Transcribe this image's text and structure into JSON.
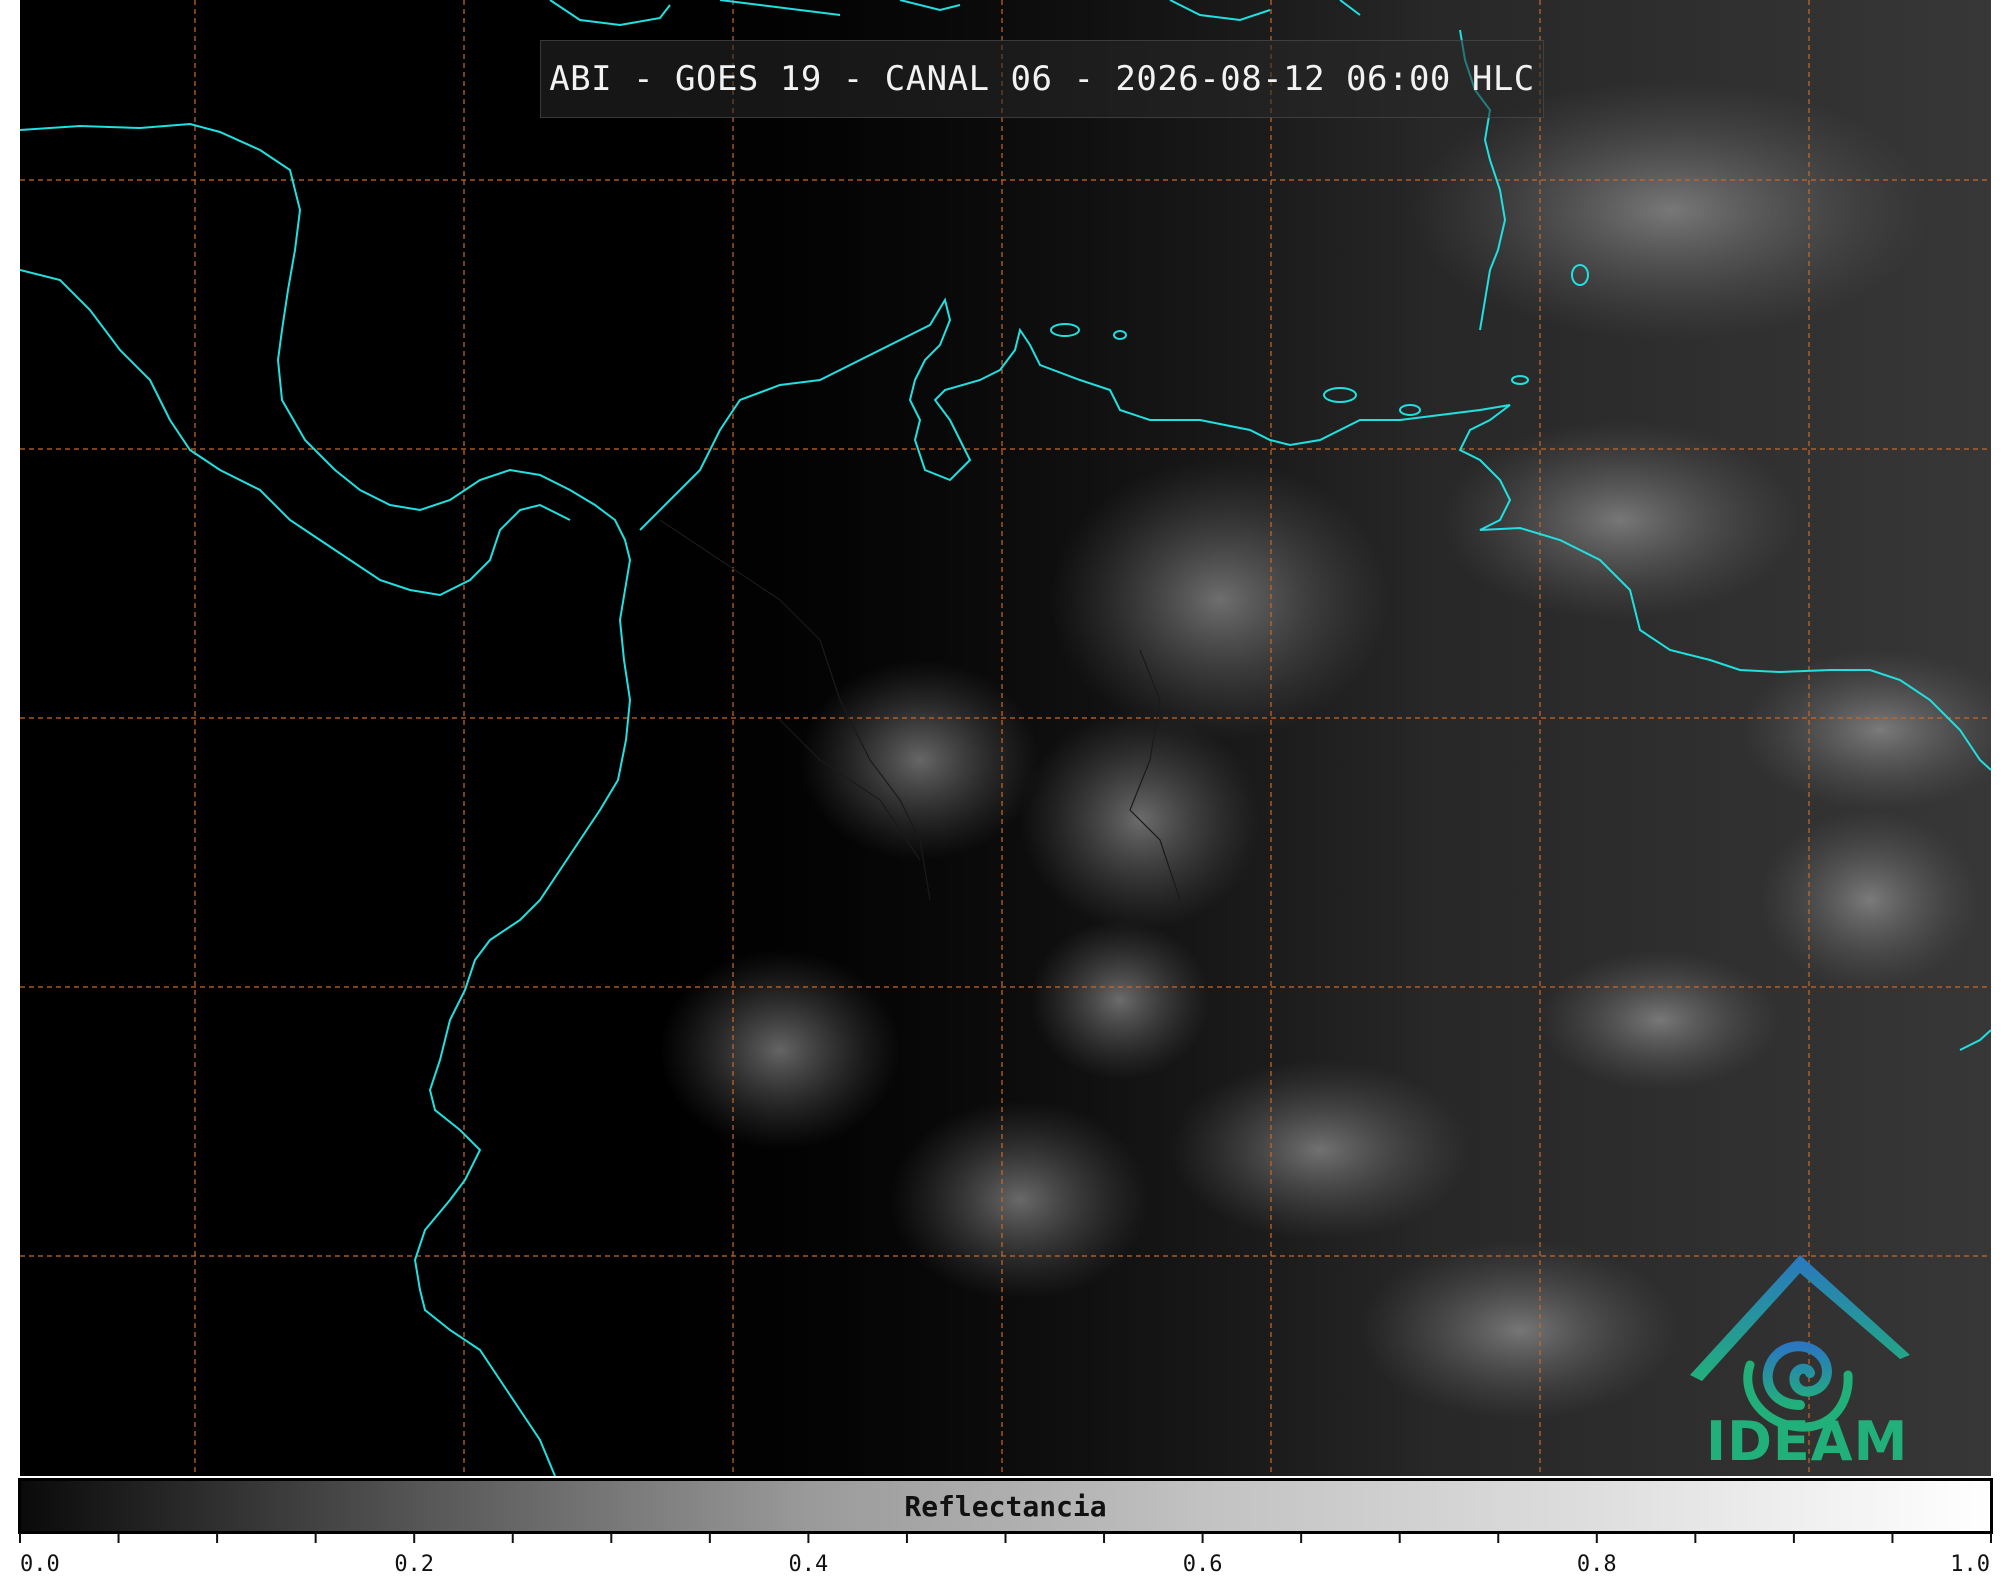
{
  "map": {
    "title": "ABI - GOES 19 - CANAL 06 - 2026-08-12 06:00 HLC",
    "coastline_color": "#20e0e0",
    "gridline_color": "#c8692a",
    "background_color": "#000000",
    "cloud_color": "#9a9a9a"
  },
  "logo": {
    "icon": "ideam-mountain-spiral-icon",
    "text": "IDEAM",
    "color": "#22b07a",
    "roof_color": "#2a77c0"
  },
  "colorbar": {
    "label": "Reflectancia",
    "min": 0.0,
    "max": 1.0,
    "tick_labels": [
      "0.0",
      "0.2",
      "0.4",
      "0.6",
      "0.8",
      "1.0"
    ],
    "major_values": [
      0.0,
      0.2,
      0.4,
      0.6,
      0.8,
      1.0
    ],
    "minor_step": 0.05,
    "colormap": "grayscale"
  }
}
